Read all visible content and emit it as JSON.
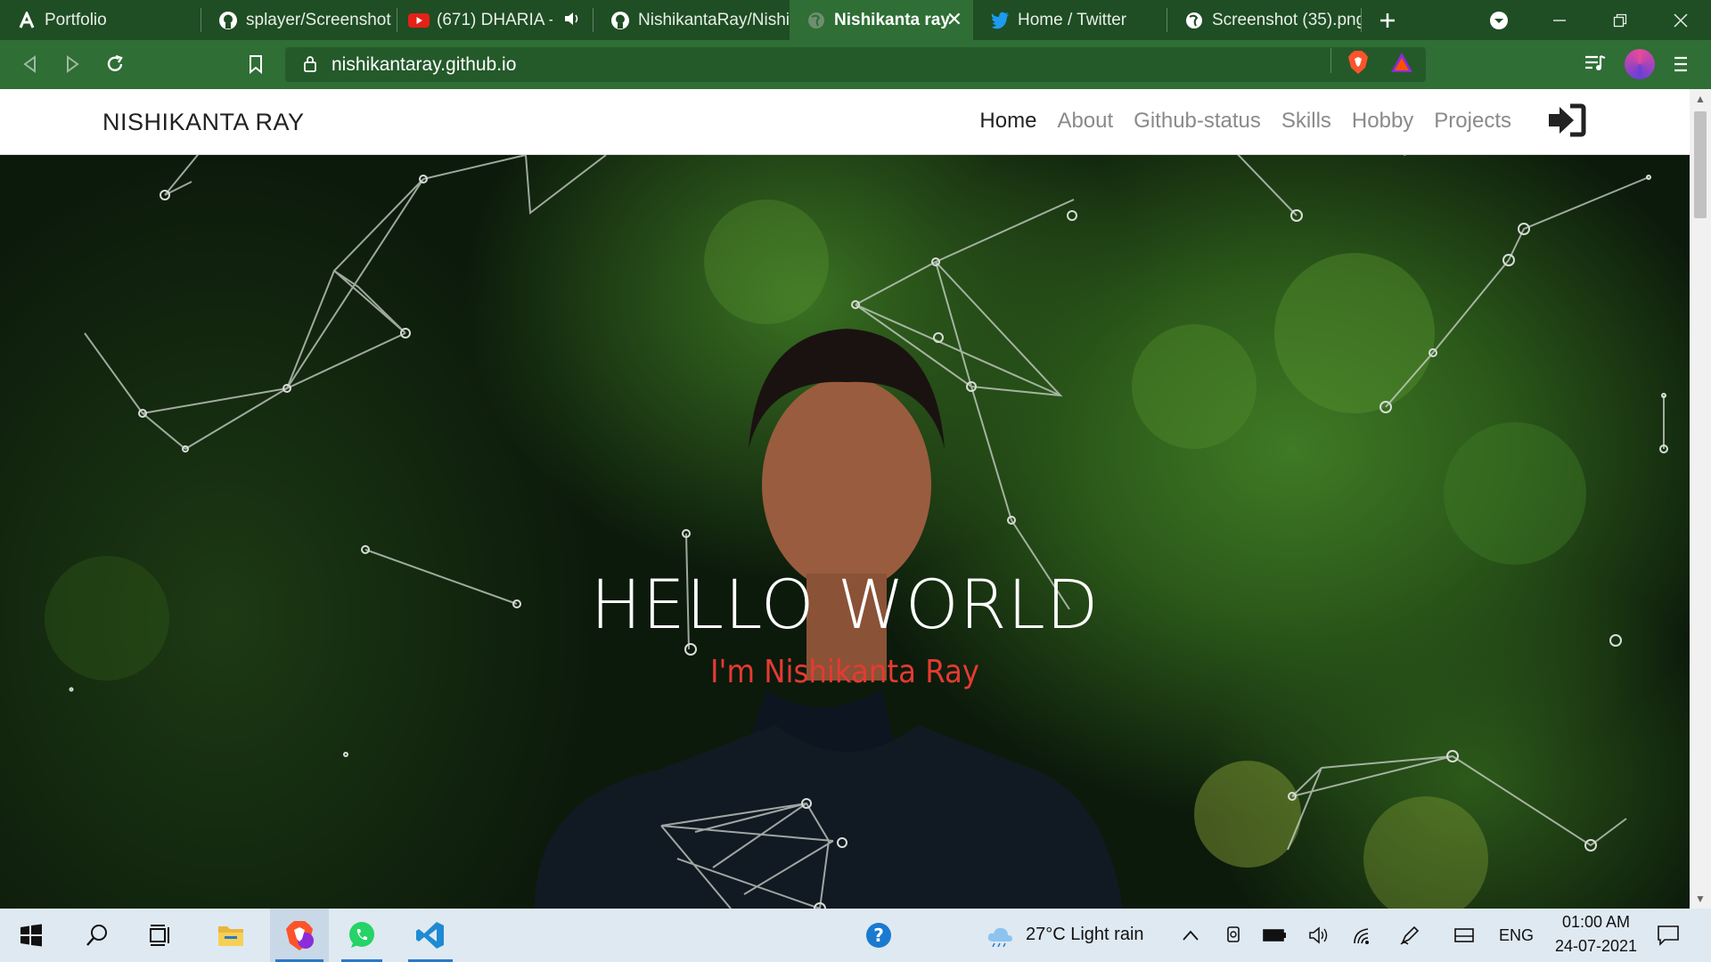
{
  "tabs": [
    {
      "title": "Portfolio",
      "icon": "arc-a-icon"
    },
    {
      "title": "splayer/Screenshot (",
      "icon": "github-icon"
    },
    {
      "title": "(671) DHARIA - S",
      "icon": "youtube-icon"
    },
    {
      "title": "NishikantaRay/Nishi",
      "icon": "github-icon"
    },
    {
      "title": "Nishikanta ray",
      "icon": "globe-icon"
    },
    {
      "title": "Home / Twitter",
      "icon": "twitter-icon"
    },
    {
      "title": "Screenshot (35).png",
      "icon": "globe-icon"
    }
  ],
  "address_bar": {
    "url": "nishikantaray.github.io"
  },
  "site": {
    "brand": "NISHIKANTA RAY",
    "nav": [
      "Home",
      "About",
      "Github-status",
      "Skills",
      "Hobby",
      "Projects"
    ],
    "hero_title": "HELLO WORLD",
    "hero_subtitle": "I'm Nishikanta Ray"
  },
  "taskbar": {
    "weather": "27°C  Light rain",
    "language": "ENG",
    "time": "01:00 AM",
    "date": "24-07-2021"
  },
  "colors": {
    "tabstrip": "#1f4d24",
    "toolbar": "#2f6e35",
    "accent_red": "#e53a33",
    "taskbar": "#dfe9f2"
  }
}
